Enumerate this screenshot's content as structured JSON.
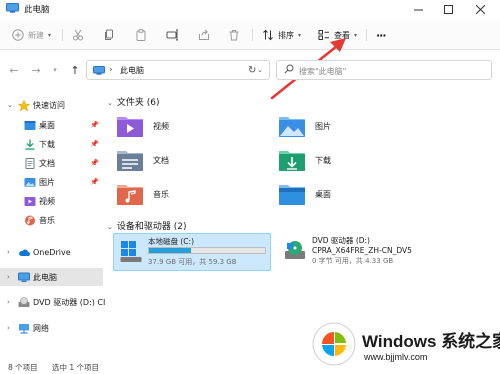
{
  "window": {
    "title": "此电脑"
  },
  "toolbar": {
    "new_label": "新建",
    "sort_label": "排序",
    "view_label": "查看",
    "more_label": "···"
  },
  "address": {
    "path": "此电脑",
    "search_placeholder": "搜索\"此电脑\""
  },
  "sidebar": {
    "quick_access": "快速访问",
    "items": [
      {
        "label": "桌面"
      },
      {
        "label": "下载"
      },
      {
        "label": "文档"
      },
      {
        "label": "图片"
      },
      {
        "label": "视频"
      },
      {
        "label": "音乐"
      }
    ],
    "onedrive": "OneDrive",
    "this_pc": "此电脑",
    "dvd": "DVD 驱动器 (D:) CI",
    "network": "网络"
  },
  "folders_section": {
    "title": "文件夹 (6)"
  },
  "folders": [
    {
      "name": "视频",
      "color": "#8e5bd8"
    },
    {
      "name": "图片",
      "color": "#3b8ee6"
    },
    {
      "name": "文档",
      "color": "#6b7f99"
    },
    {
      "name": "下载",
      "color": "#1f9e72"
    },
    {
      "name": "音乐",
      "color": "#e0674a"
    },
    {
      "name": "桌面",
      "color": "#2f8fe0"
    }
  ],
  "drives_section": {
    "title": "设备和驱动器 (2)"
  },
  "drives": [
    {
      "name": "本地磁盘 (C:)",
      "size": "37.9 GB 可用，共 59.3 GB",
      "used_fraction": 0.36
    },
    {
      "name": "DVD 驱动器 (D:)",
      "volume": "CPRA_X64FRE_ZH-CN_DV5",
      "size": "0 字节 可用，共 4.33 GB"
    }
  ],
  "status": {
    "count": "8 个项目",
    "selected": "选中 1 个项目"
  },
  "watermark": {
    "brand": "Windows",
    "brand_cn": "系统之家",
    "url": "www.bjjmlv.com"
  },
  "colors": {
    "accent": "#0067c0",
    "selection": "#cce8ff",
    "arrow": "#e53935"
  }
}
